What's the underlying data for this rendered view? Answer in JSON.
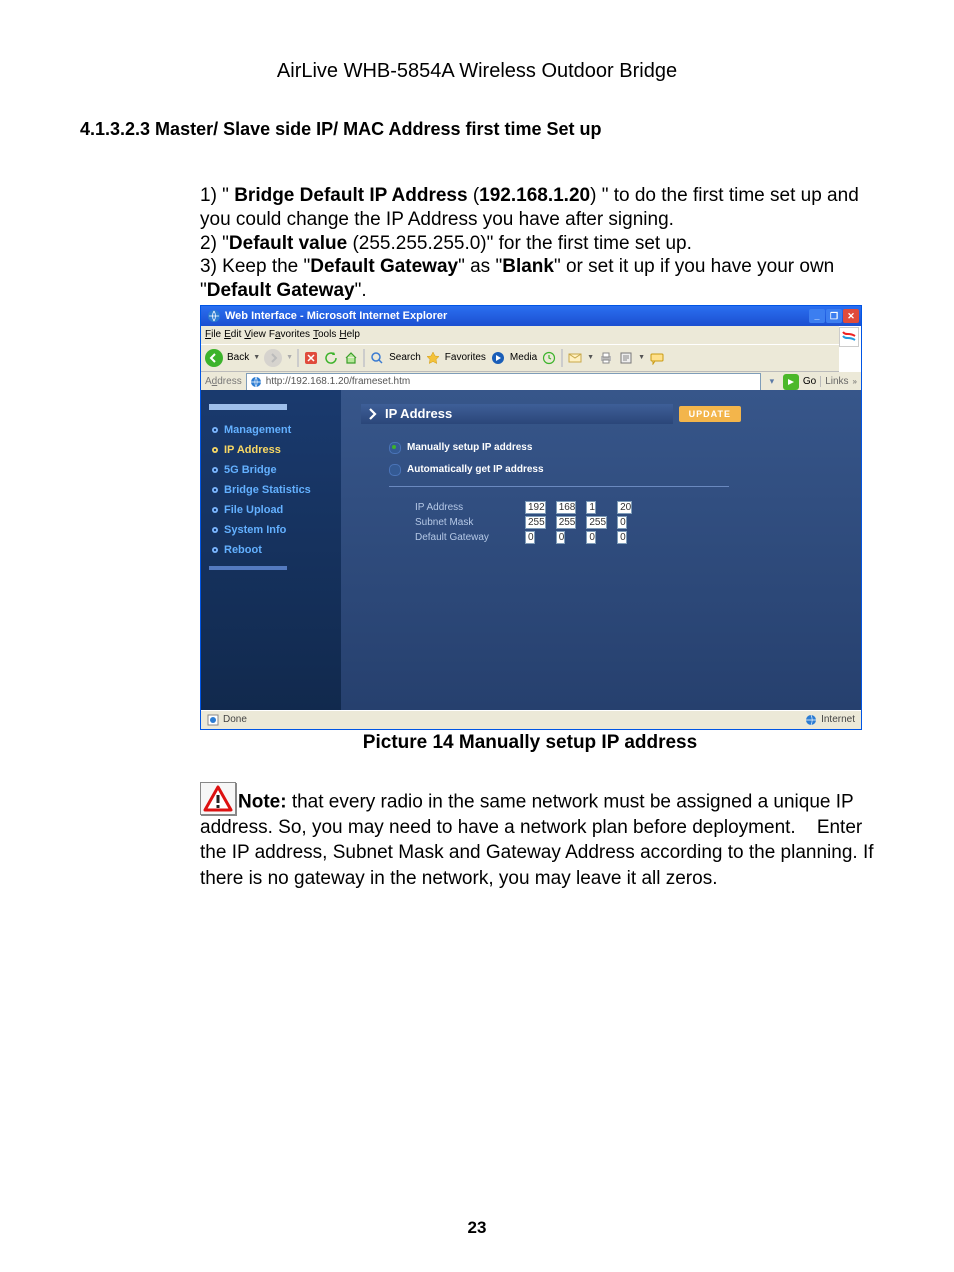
{
  "doc_title": "AirLive WHB-5854A Wireless Outdoor Bridge",
  "section_heading": "4.1.3.2.3 Master/ Slave side IP/ MAC Address first time Set up",
  "body": {
    "line1_a": "1) \" ",
    "line1_b": "Bridge Default IP Address",
    "line1_c": " (",
    "line1_d": "192.168.1.20",
    "line1_e": ") \" to do the first time set up and you could change the IP Address you have after signing.",
    "line2_a": "2) \"",
    "line2_b": "Default value",
    "line2_c": " (255.255.255.0)\" for the first time set up.",
    "line3_a": "3) Keep the \"",
    "line3_b": "Default Gateway",
    "line3_c": "\" as \"",
    "line3_d": "Blank",
    "line3_e": "\" or set it up if you have your own \"",
    "line3_f": "Default Gateway",
    "line3_g": "\"."
  },
  "shot": {
    "title": "Web Interface - Microsoft Internet Explorer",
    "menu": {
      "file": "File",
      "edit": "Edit",
      "view": "View",
      "favorites": "Favorites",
      "tools": "Tools",
      "help": "Help"
    },
    "toolbar": {
      "back": "Back",
      "search": "Search",
      "favorites": "Favorites",
      "media": "Media"
    },
    "addr": {
      "label": "Address",
      "url": "http://192.168.1.20/frameset.htm",
      "go": "Go",
      "links": "Links"
    },
    "sidebar": {
      "items": [
        {
          "label": "Management",
          "active": false
        },
        {
          "label": "IP Address",
          "active": true
        },
        {
          "label": "5G Bridge",
          "active": false
        },
        {
          "label": "Bridge Statistics",
          "active": false
        },
        {
          "label": "File Upload",
          "active": false
        },
        {
          "label": "System Info",
          "active": false
        },
        {
          "label": "Reboot",
          "active": false
        }
      ]
    },
    "panel": {
      "title": "IP Address",
      "update": "UPDATE",
      "radio_manual": "Manually setup IP address",
      "radio_auto": "Automatically get IP address",
      "fields": {
        "ip": {
          "label": "IP Address",
          "v": [
            "192",
            "168",
            "1",
            "20"
          ]
        },
        "mask": {
          "label": "Subnet Mask",
          "v": [
            "255",
            "255",
            "255",
            "0"
          ]
        },
        "gw": {
          "label": "Default Gateway",
          "v": [
            "0",
            "0",
            "0",
            "0"
          ]
        }
      }
    },
    "status": {
      "done": "Done",
      "zone": "Internet"
    }
  },
  "caption": "Picture 14 Manually setup IP address",
  "note_label": "Note:",
  "note_text": " that every radio in the same network must be assigned a unique IP address. So, you may need to have a network plan before deployment.    Enter the IP address, Subnet Mask and Gateway Address according to the planning. If there is no gateway in the network, you may leave it all zeros.",
  "page_num": "23"
}
